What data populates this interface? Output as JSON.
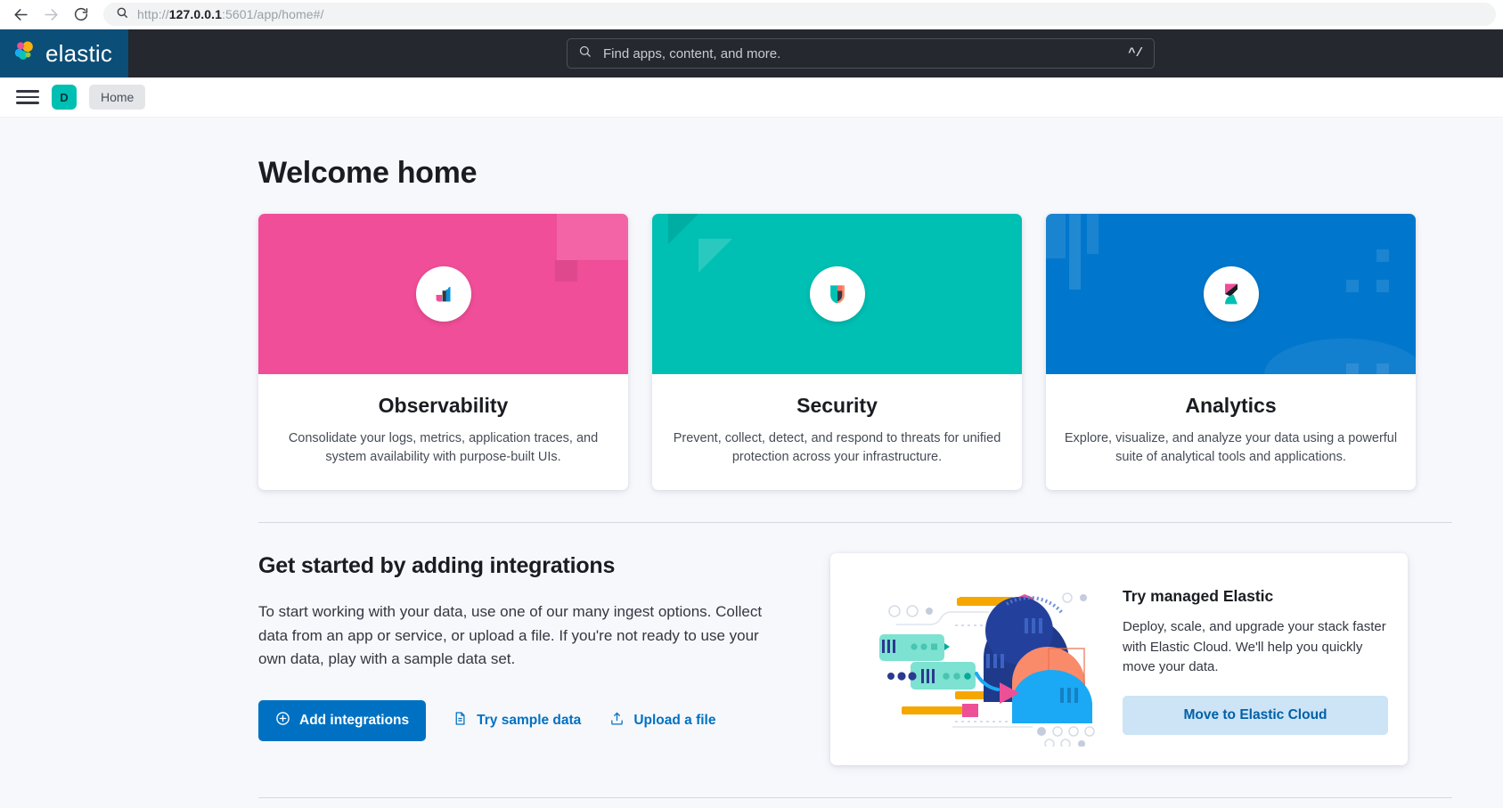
{
  "browser": {
    "back_icon": "back-arrow-icon",
    "forward_icon": "forward-arrow-icon",
    "reload_icon": "reload-icon",
    "search_icon": "search-icon",
    "url_host": "127.0.0.1",
    "url_prefix": "http://",
    "url_suffix": ":5601/app/home#/",
    "url_full": "http://127.0.0.1:5601/app/home#/"
  },
  "header": {
    "logo_text": "elastic",
    "logo_bg": "#0B4E78",
    "bar_bg": "#25282F",
    "search_placeholder": "Find apps, content, and more.",
    "search_shortcut": "^/"
  },
  "subnav": {
    "menu_icon": "hamburger-menu-icon",
    "avatar_initial": "D",
    "avatar_color": "#00BFB3",
    "breadcrumb": "Home"
  },
  "main": {
    "page_title": "Welcome home",
    "cards": [
      {
        "id": "observability",
        "title": "Observability",
        "description": "Consolidate your logs, metrics, application traces, and system availability with purpose-built UIs.",
        "color": "#F04E98",
        "icon": "observability-bars-icon"
      },
      {
        "id": "security",
        "title": "Security",
        "description": "Prevent, collect, detect, and respond to threats for unified protection across your infrastructure.",
        "color": "#00BFB3",
        "icon": "security-shield-icon"
      },
      {
        "id": "analytics",
        "title": "Analytics",
        "description": "Explore, visualize, and analyze your data using a powerful suite of analytical tools and applications.",
        "color": "#0077CC",
        "icon": "kibana-analytics-icon"
      }
    ]
  },
  "get_started": {
    "title": "Get started by adding integrations",
    "paragraph": "To start working with your data, use one of our many ingest options. Collect data from an app or service, or upload a file. If you're not ready to use your own data, play with a sample data set.",
    "buttons": {
      "add_integrations": "Add integrations",
      "add_integrations_icon": "plus-circle-icon",
      "try_sample_data": "Try sample data",
      "try_sample_data_icon": "document-icon",
      "upload_file": "Upload a file",
      "upload_file_icon": "upload-icon"
    },
    "primary_color": "#0071C2"
  },
  "cloud_promo": {
    "illustration": "elastic-cloud-illustration",
    "title": "Try managed Elastic",
    "description": "Deploy, scale, and upgrade your stack faster with Elastic Cloud. We'll help you quickly move your data.",
    "button_label": "Move to Elastic Cloud",
    "button_bg": "#CCE4F5",
    "button_color": "#0060A8"
  }
}
